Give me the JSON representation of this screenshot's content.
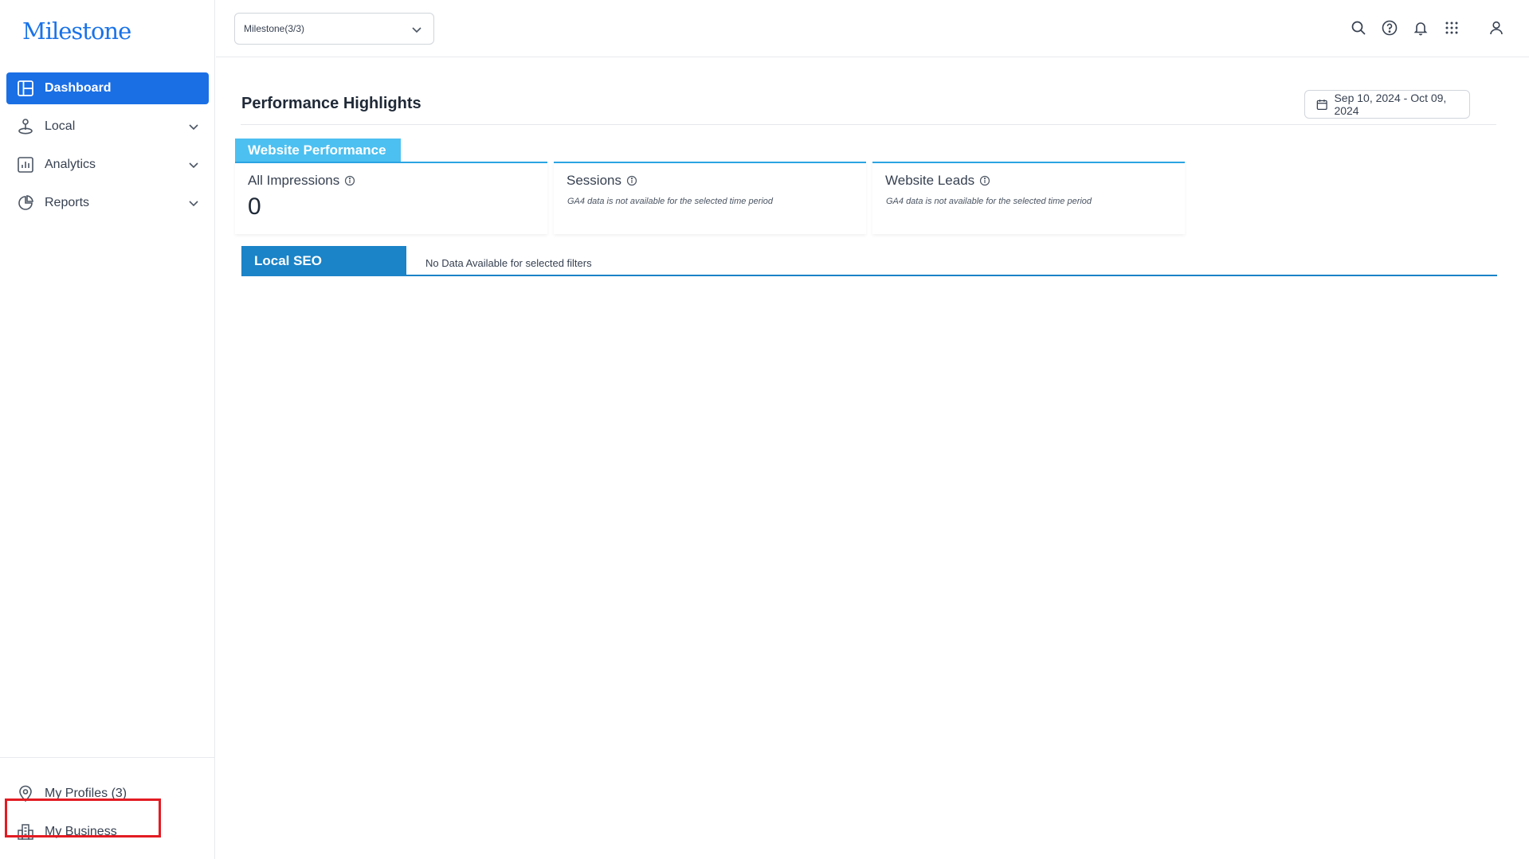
{
  "app": {
    "logo_text": "Milestone",
    "brand_color": "#1a73e8"
  },
  "sidebar": {
    "items": [
      {
        "label": "Dashboard",
        "icon": "dashboard-icon",
        "active": true
      },
      {
        "label": "Local",
        "icon": "location-pin-person-icon",
        "expandable": true
      },
      {
        "label": "Analytics",
        "icon": "bar-chart-icon",
        "expandable": true
      },
      {
        "label": "Reports",
        "icon": "pie-chart-icon",
        "expandable": true
      }
    ],
    "bottom_items": [
      {
        "label": "My Profiles (3)",
        "icon": "map-pin-icon"
      },
      {
        "label": "My Business",
        "icon": "building-icon",
        "highlighted": true
      }
    ]
  },
  "topbar": {
    "selector_value": "Milestone(3/3)",
    "icons": [
      "search-icon",
      "help-icon",
      "bell-icon",
      "apps-grid-icon",
      "user-icon"
    ]
  },
  "main": {
    "title": "Performance Highlights",
    "date_range": "Sep 10, 2024 - Oct 09, 2024",
    "website_performance": {
      "tab_label": "Website Performance",
      "tab_color": "#4cc0f1",
      "cards": [
        {
          "title": "All Impressions",
          "value": "0"
        },
        {
          "title": "Sessions",
          "note": "GA4 data is not available for the selected time period"
        },
        {
          "title": "Website Leads",
          "note": "GA4 data is not available for the selected time period"
        }
      ]
    },
    "local_seo": {
      "tab_label": "Local SEO",
      "tab_color": "#1b83c7",
      "message": "No Data Available for selected filters"
    }
  },
  "highlight_color": "#e31b23"
}
